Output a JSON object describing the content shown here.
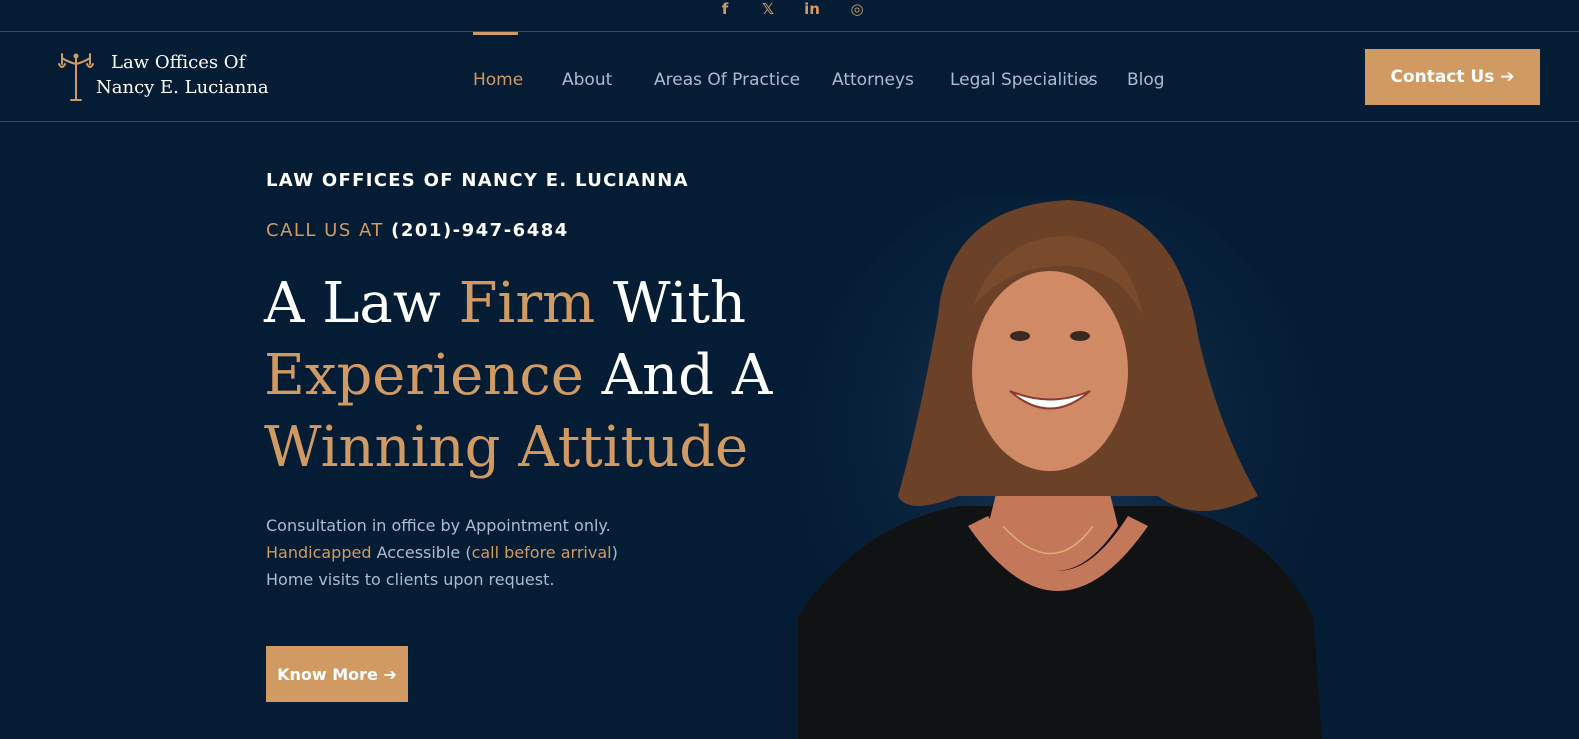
{
  "social": [
    {
      "name": "facebook-icon",
      "glyph": "f"
    },
    {
      "name": "x-icon",
      "glyph": "𝕏"
    },
    {
      "name": "linkedin-icon",
      "glyph": "in"
    },
    {
      "name": "instagram-icon",
      "glyph": "◎"
    }
  ],
  "logo": {
    "line1": "Law Offices Of",
    "line2": "Nancy E. Lucianna"
  },
  "nav": {
    "items": [
      "Home",
      "About",
      "Areas Of Practice",
      "Attorneys",
      "Legal Specialities",
      "Blog"
    ],
    "active": "Home",
    "contact_label": "Contact Us ➔"
  },
  "hero": {
    "eyebrow": "LAW OFFICES OF NANCY E. LUCIANNA",
    "call_label": "CALL US AT",
    "phone": "(201)-947-6484",
    "headline": {
      "w1": "A Law",
      "w2": "Firm",
      "w3": "With",
      "w4": "Experience",
      "w5": "And A",
      "w6": "Winning Attitude"
    },
    "line1": "Consultation in office by Appointment only.",
    "line2a": "Handicapped",
    "line2b": " Accessible (",
    "line2c": "call before arrival",
    "line2d": ")",
    "line3": "Home visits to clients upon request.",
    "cta_label": "Know More ➔"
  },
  "colors": {
    "background": "#041c34",
    "accent": "#d29a63",
    "muted_text": "#a9bdd2"
  }
}
